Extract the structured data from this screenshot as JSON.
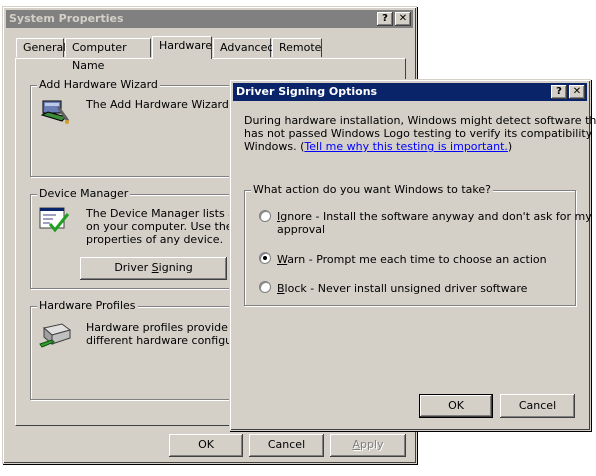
{
  "sysprops": {
    "title": "System Properties",
    "help_btn": "?",
    "close_btn": "✕",
    "tabs": [
      "General",
      "Computer Name",
      "Hardware",
      "Advanced",
      "Remote"
    ],
    "add_hw": {
      "label": "Add Hardware Wizard",
      "text": "The Add Hardware Wizard hel"
    },
    "devmgr": {
      "label": "Device Manager",
      "text_lines": [
        "The Device Manager lists all th",
        "on your computer. Use the Dev",
        "properties of any device."
      ],
      "driver_signing_prefix": "Driver ",
      "driver_signing_acc": "S",
      "driver_signing_suffix": "igning"
    },
    "hwprofiles": {
      "label": "Hardware Profiles",
      "text_lines": [
        "Hardware profiles provide a wa",
        "different hardware configuratio"
      ]
    },
    "ok": "OK",
    "cancel": "Cancel",
    "apply_acc": "A",
    "apply_rest": "pply"
  },
  "driver_dialog": {
    "title": "Driver Signing Options",
    "help_btn": "?",
    "close_btn": "✕",
    "intro_lines": [
      "During hardware installation, Windows might detect software that",
      "has not passed Windows Logo testing to verify its compatibility with"
    ],
    "intro_prefix": "Windows. (",
    "link_text": "Tell me why this testing is important.",
    "intro_suffix": ")",
    "group_label": "What action do you want Windows to take?",
    "options": [
      {
        "acc": "I",
        "rest": "gnore - Install the software anyway and don't ask for my",
        "line2": "approval",
        "selected": false
      },
      {
        "acc": "W",
        "rest": "arn - Prompt me each time to choose an action",
        "line2": "",
        "selected": true
      },
      {
        "acc": "B",
        "rest": "lock - Never install unsigned driver software",
        "line2": "",
        "selected": false
      }
    ],
    "ok": "OK",
    "cancel": "Cancel"
  }
}
